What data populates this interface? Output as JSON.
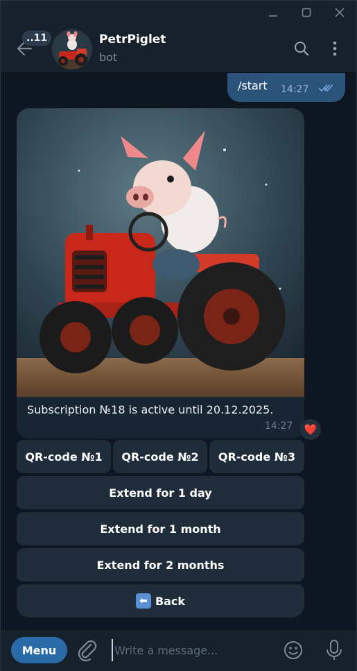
{
  "window": {
    "minimize_icon": "minimize-icon",
    "maximize_icon": "maximize-icon",
    "close_icon": "close-icon"
  },
  "header": {
    "unread_count": "..11",
    "title": "PetrPiglet",
    "subtitle": "bot"
  },
  "messages": {
    "outgoing": {
      "text": "/start",
      "time": "14:27",
      "status": "read"
    },
    "incoming": {
      "caption": "Subscription №18 is active until 20.12.2025.",
      "time": "14:27",
      "reaction": "❤️"
    }
  },
  "keyboard": {
    "row1": [
      "QR-code №1",
      "QR-code №2",
      "QR-code №3"
    ],
    "extend_day": "Extend for 1 day",
    "extend_month": "Extend for 1 month",
    "extend_2months": "Extend for 2 months",
    "back": "Back",
    "back_emoji": "⬅"
  },
  "composer": {
    "menu": "Menu",
    "placeholder": "Write a message..."
  },
  "colors": {
    "accent": "#2b6ca8",
    "outgoing_bubble": "#2b5278",
    "incoming_bubble": "#182533",
    "background": "#0e1621"
  }
}
